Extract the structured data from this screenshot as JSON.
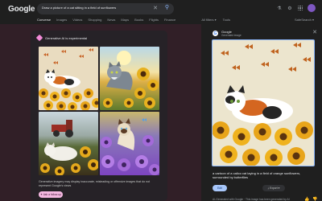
{
  "header": {
    "logo": "Google",
    "search_query": "Draw a picture of a cat sitting in a field of sunflowers",
    "tabs": [
      "Converse",
      "Images",
      "Videos",
      "Shopping",
      "News",
      "Maps",
      "Books",
      "Flights",
      "Finance"
    ],
    "active_tab_index": 0,
    "tools": [
      "All filters ▾",
      "Tools"
    ],
    "safesearch": "SafeSearch ▾"
  },
  "card": {
    "title": "Generative AI is experimental",
    "disclaimer": "Generative imagery may display inaccurate, misleading or offensive images that do not represent Google's views",
    "ask_button": "Ask a follow-up"
  },
  "detail": {
    "source_name": "Google",
    "source_sub": "Generated image",
    "description": "a cartoon of a calico cat laying in a field of orange sunflowers, surrounded by butterflies",
    "edit_label": "Edit",
    "export_label": "Export",
    "generated_note": "AI-Generated with Google · This image has been generated by AI"
  },
  "colors": {
    "page_bg": "#1f1f1f",
    "left_panel_bg": "#311f27",
    "accent_pink": "#f5b9e2",
    "accent_blue": "#a8c7fa",
    "selection_border": "#8ab4f8"
  }
}
